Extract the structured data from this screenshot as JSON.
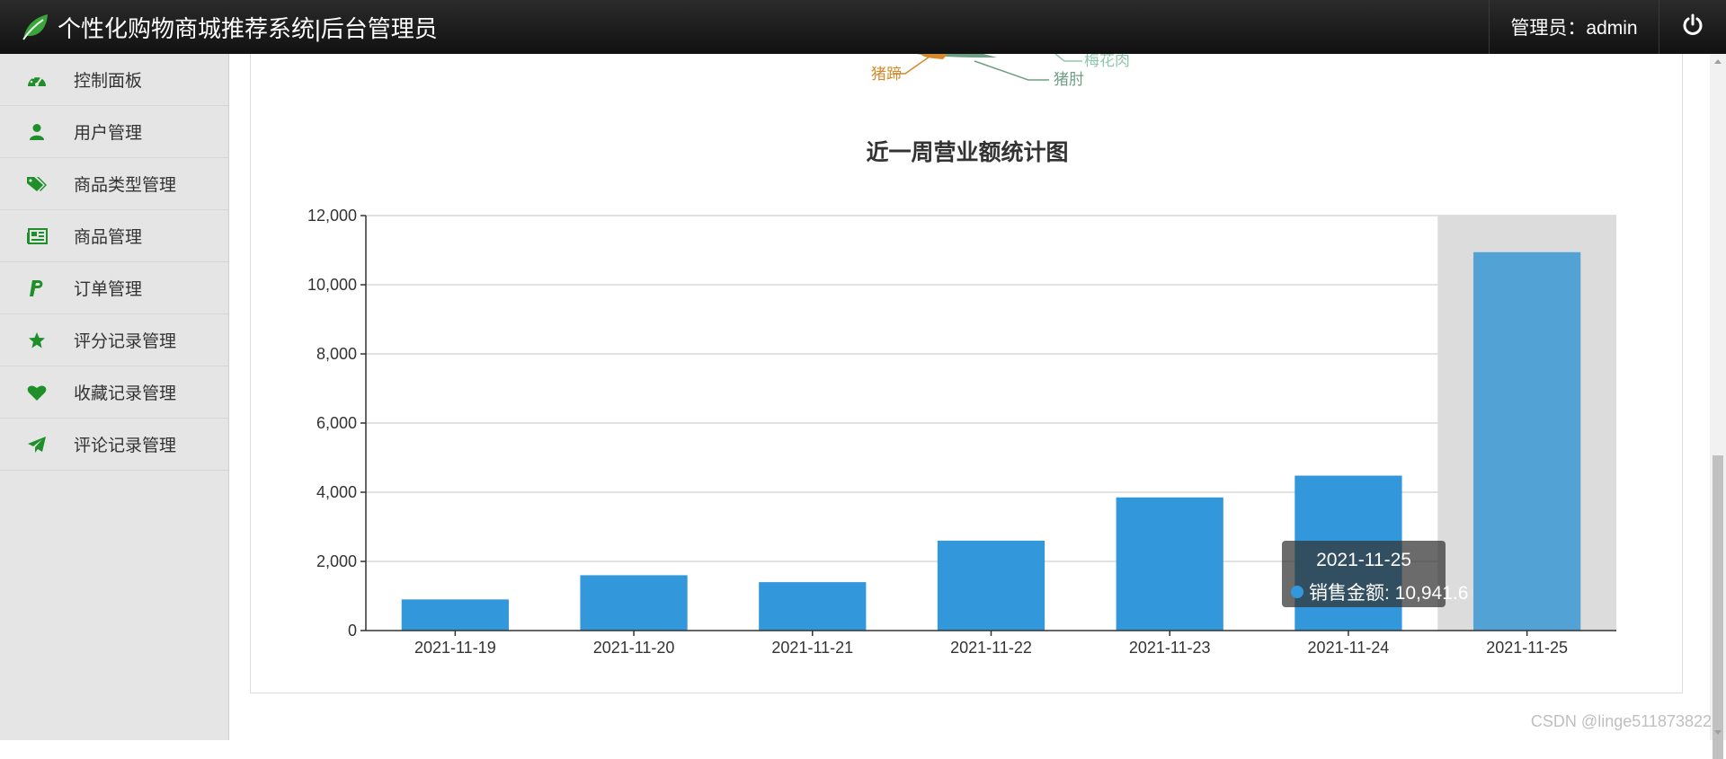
{
  "header": {
    "app_title": "个性化购物商城推荐系统|后台管理员",
    "admin_label": "管理员：admin",
    "brand_icon": "leaf-icon",
    "logout_icon": "power-icon"
  },
  "sidebar": {
    "items": [
      {
        "label": "控制面板",
        "icon": "dashboard-icon"
      },
      {
        "label": "用户管理",
        "icon": "user-icon"
      },
      {
        "label": "商品类型管理",
        "icon": "tags-icon"
      },
      {
        "label": "商品管理",
        "icon": "newspaper-icon"
      },
      {
        "label": "订单管理",
        "icon": "paypal-icon"
      },
      {
        "label": "评分记录管理",
        "icon": "star-icon"
      },
      {
        "label": "收藏记录管理",
        "icon": "heart-icon"
      },
      {
        "label": "评论记录管理",
        "icon": "paper-plane-icon"
      }
    ],
    "accent_color": "#1f8f2a"
  },
  "pie_partial": {
    "labels": [
      "猪蹄",
      "梅花肉",
      "猪肘"
    ],
    "colors": [
      "#d48a2a",
      "#91c7ae",
      "#6e9e84"
    ]
  },
  "chart_data": {
    "type": "bar",
    "title": "近一周营业额统计图",
    "categories": [
      "2021-11-19",
      "2021-11-20",
      "2021-11-21",
      "2021-11-22",
      "2021-11-23",
      "2021-11-24",
      "2021-11-25"
    ],
    "series": [
      {
        "name": "销售金额",
        "values": [
          900,
          1600,
          1400,
          2600,
          3850,
          4480,
          10941.6
        ],
        "color": "#3398db"
      }
    ],
    "ylim": [
      0,
      12000
    ],
    "yticks": [
      "0",
      "2,000",
      "4,000",
      "6,000",
      "8,000",
      "10,000",
      "12,000"
    ],
    "grid": true,
    "highlighted_category": "2021-11-25"
  },
  "tooltip": {
    "date": "2021-11-25",
    "text": "销售金额: 10,941.6"
  },
  "watermark": "CSDN @linge511873822"
}
